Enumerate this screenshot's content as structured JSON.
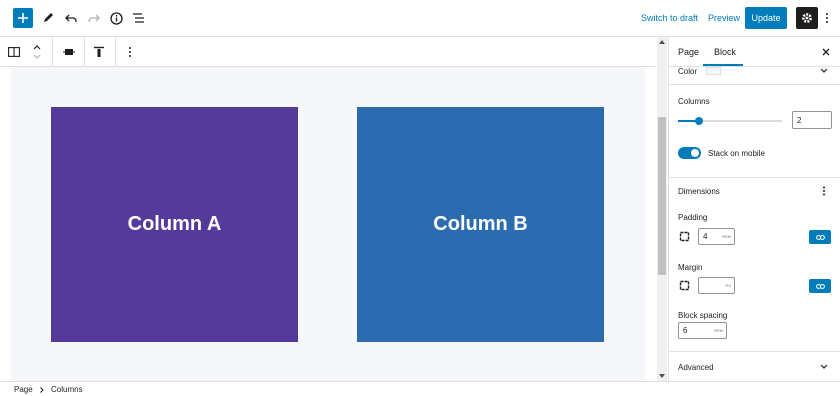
{
  "topbar": {
    "switch_to_draft": "Switch to draft",
    "preview": "Preview",
    "update": "Update"
  },
  "canvas": {
    "column_a": "Column A",
    "column_b": "Column B",
    "colors": {
      "column_a_bg": "#543a9a",
      "column_b_bg": "#2b6cb0"
    }
  },
  "sidebar": {
    "tabs": [
      "Page",
      "Block"
    ],
    "active_tab": "Block",
    "color_label": "Color",
    "columns_label": "Columns",
    "columns_value": "2",
    "stack_label": "Stack on mobile",
    "stack_enabled": true,
    "dimensions_label": "Dimensions",
    "padding_label": "Padding",
    "padding_value": "4",
    "padding_unit": "REM",
    "margin_label": "Margin",
    "margin_value": "",
    "margin_unit": "PX",
    "block_spacing_label": "Block spacing",
    "block_spacing_value": "6",
    "block_spacing_unit": "REM",
    "advanced_label": "Advanced"
  },
  "footer": {
    "breadcrumb": [
      "Page",
      "Columns"
    ]
  },
  "accent": "#007cba"
}
